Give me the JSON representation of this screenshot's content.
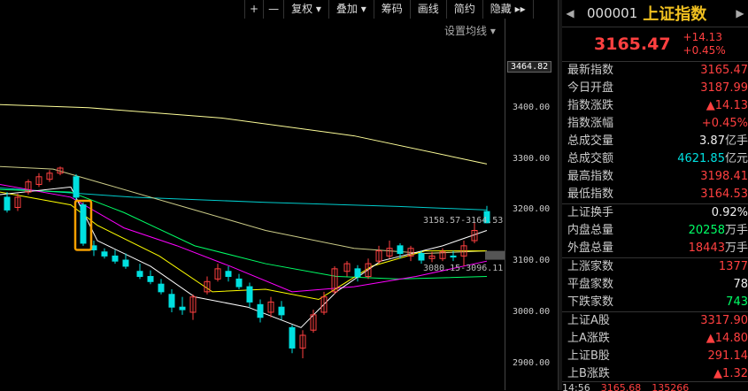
{
  "toolbar": {
    "buttons": [
      "+",
      "—",
      "复权 ▾",
      "叠加 ▾",
      "筹码",
      "画线",
      "简约",
      "隐藏 ▸▸"
    ]
  },
  "ma_setting": "设置均线 ▾",
  "price_axis": {
    "current_label": "3464.82",
    "ticks": [
      "3400.00",
      "3300.00",
      "3200.00",
      "3100.00",
      "3000.00",
      "2900.00"
    ]
  },
  "chart_annotations": {
    "marker_upper": "3158.57-3164.53",
    "marker_lower": "3080.15-3096.11"
  },
  "panel": {
    "code": "000001",
    "name": "上证指数",
    "price": "3165.47",
    "change": "+14.13",
    "change_pct": "+0.45%",
    "rows": [
      {
        "label": "最新指数",
        "value": "3165.47",
        "color": "red"
      },
      {
        "label": "今日开盘",
        "value": "3187.99",
        "color": "red"
      },
      {
        "label": "指数涨跌",
        "value": "▲14.13",
        "color": "red"
      },
      {
        "label": "指数涨幅",
        "value": "+0.45%",
        "color": "red"
      },
      {
        "label": "总成交量",
        "value": "3.87",
        "unit": "亿手",
        "color": "white"
      },
      {
        "label": "总成交额",
        "value": "4621.85",
        "unit": "亿元",
        "color": "cyan"
      },
      {
        "label": "最高指数",
        "value": "3198.41",
        "color": "red"
      },
      {
        "label": "最低指数",
        "value": "3164.53",
        "color": "red"
      },
      {
        "label": "上证换手",
        "value": "0.92%",
        "color": "white",
        "sep": true
      },
      {
        "label": "内盘总量",
        "value": "20258",
        "unit": "万手",
        "color": "green"
      },
      {
        "label": "外盘总量",
        "value": "18443",
        "unit": "万手",
        "color": "red"
      },
      {
        "label": "上涨家数",
        "value": "1377",
        "color": "red",
        "sep": true
      },
      {
        "label": "平盘家数",
        "value": "78",
        "color": "white"
      },
      {
        "label": "下跌家数",
        "value": "743",
        "color": "green"
      },
      {
        "label": "上证A股",
        "value": "3317.90",
        "color": "red",
        "sep": true
      },
      {
        "label": "上A涨跌",
        "value": "▲14.80",
        "color": "red"
      },
      {
        "label": "上证B股",
        "value": "291.14",
        "color": "red"
      },
      {
        "label": "上B涨跌",
        "value": "▲1.32",
        "color": "red"
      }
    ],
    "bottom": [
      "14:56",
      "3165.68",
      "135266"
    ]
  },
  "colors": {
    "up": "#ff4040",
    "down": "#00e0e0",
    "ma5": "#ffffff",
    "ma10": "#ffff00",
    "ma20": "#ff00ff",
    "ma30": "#00ff66",
    "ma60": "#cccc88",
    "ma120": "#ffff99",
    "ma250": "#00cccc",
    "highlight_box": "#f5a000"
  }
}
